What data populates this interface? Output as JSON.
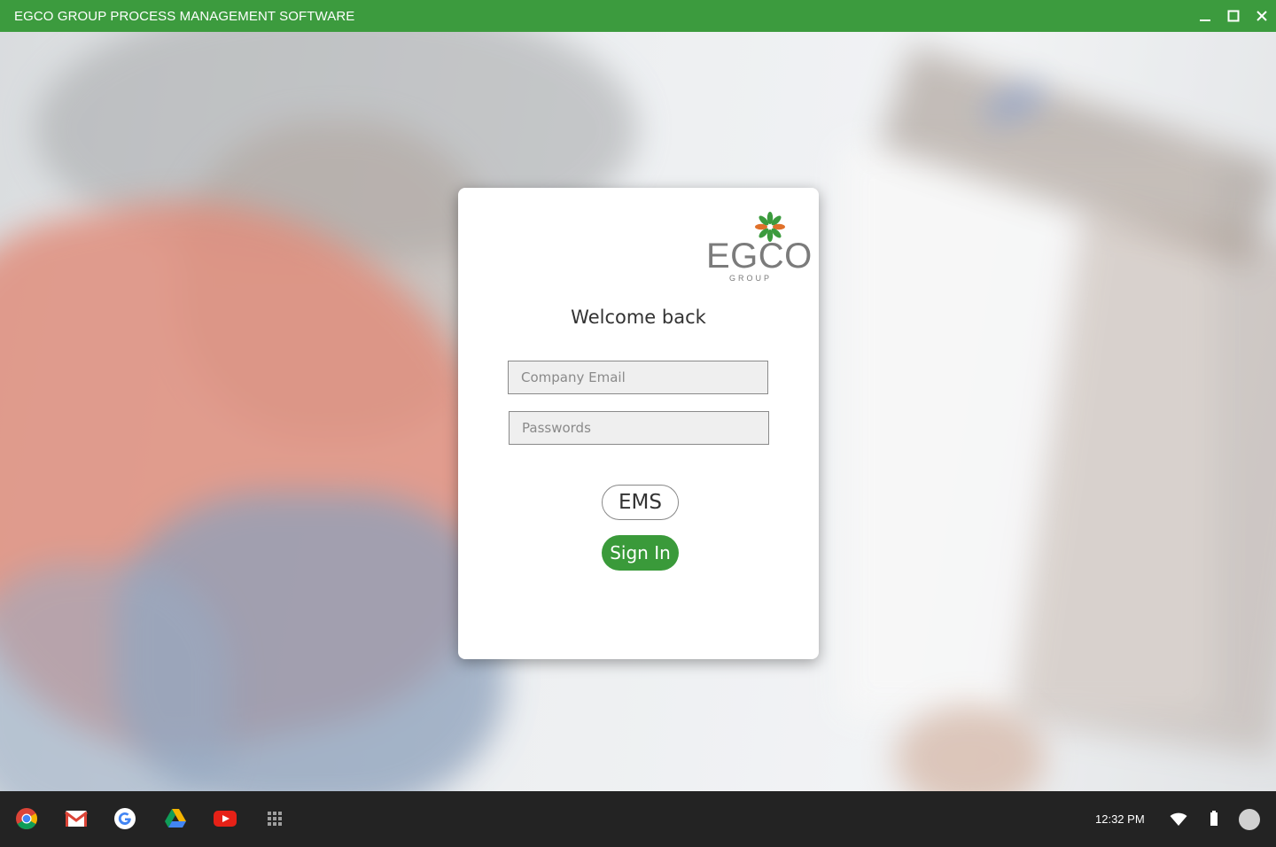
{
  "window": {
    "title": "EGCO GROUP PROCESS MANAGEMENT SOFTWARE",
    "controls": [
      "minimize-icon",
      "maximize-icon",
      "close-icon"
    ]
  },
  "login": {
    "logo": {
      "word": "EGCO",
      "sub": "GROUP"
    },
    "heading": "Welcome back",
    "email_placeholder": "Company Email",
    "email_value": "",
    "password_placeholder": "Passwords",
    "password_value": "",
    "ems_label": "EMS",
    "signin_label": "Sign In"
  },
  "taskbar": {
    "apps": [
      "chrome-icon",
      "gmail-icon",
      "google-icon",
      "drive-icon",
      "youtube-icon",
      "app-launcher-icon"
    ],
    "time": "12:32 PM",
    "tray": [
      "wifi-icon",
      "battery-icon",
      "account-avatar"
    ]
  },
  "colors": {
    "brand_green": "#3c9b3e",
    "signin_green": "#3a9a3a",
    "taskbar": "#232323"
  }
}
